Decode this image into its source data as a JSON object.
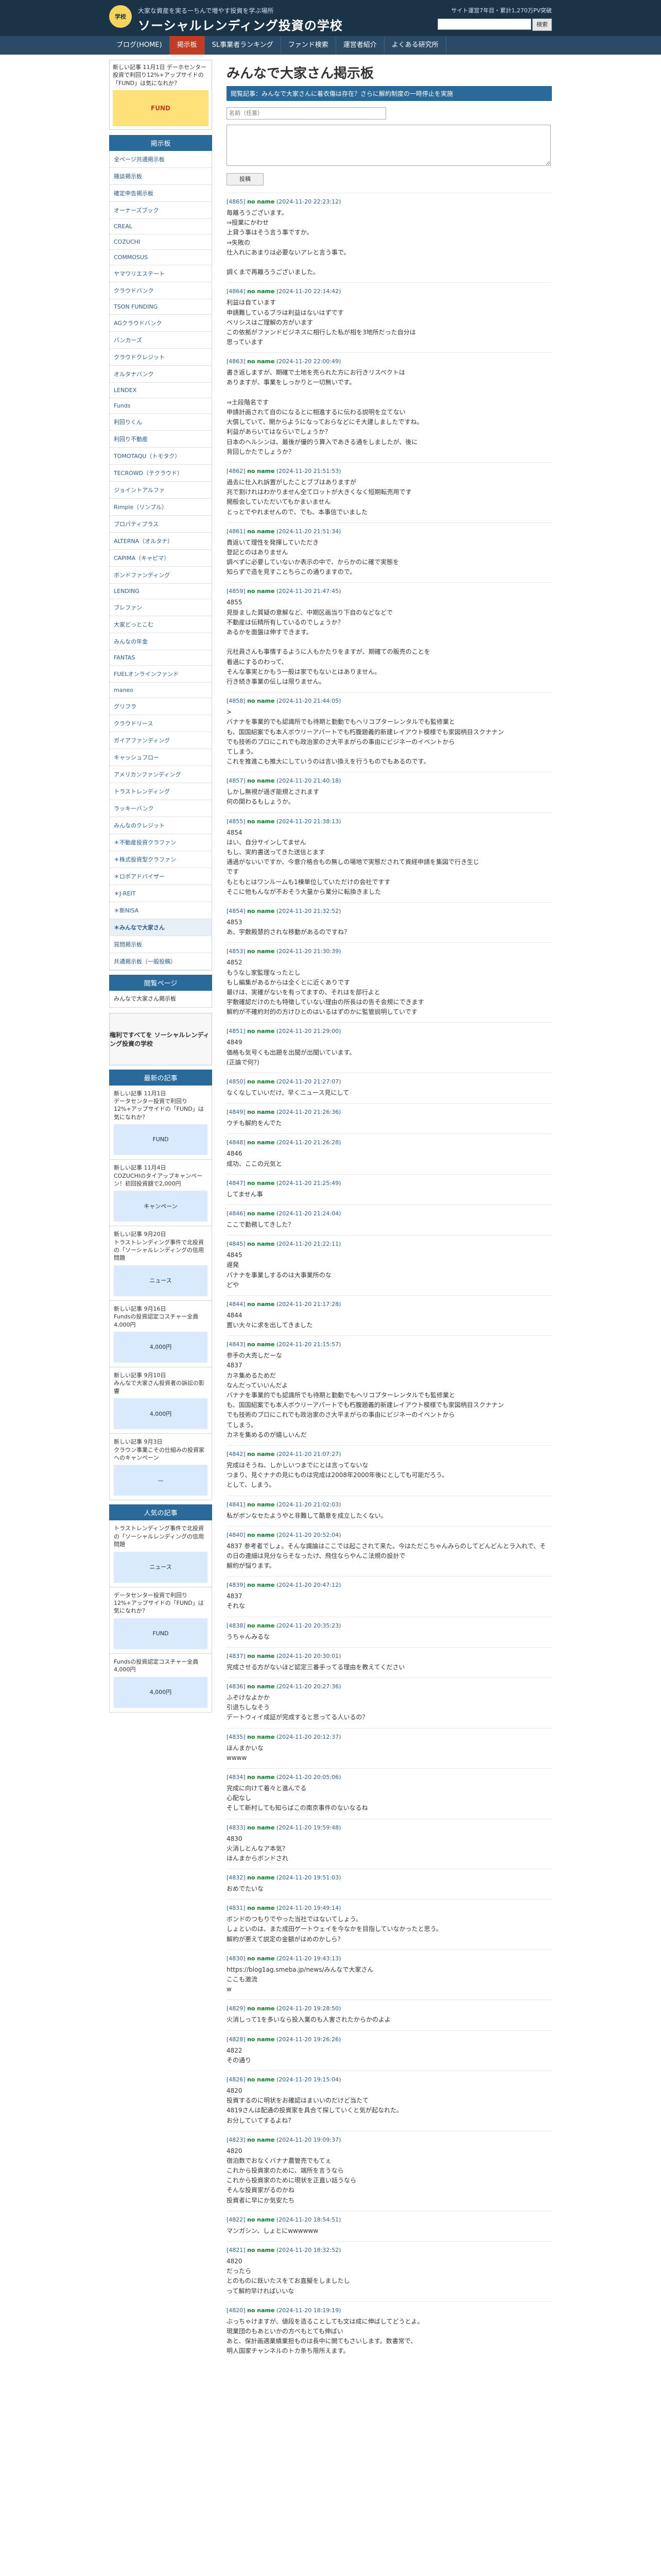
{
  "header": {
    "tagline": "大家な資産を実るーちんで増やす投資を学ぶ場所",
    "site_name": "ソーシャルレンディング投資の学校",
    "stats": "サイト運営7年目・累計1,270万PV突破",
    "logo_text": "学校",
    "search_button": "検索"
  },
  "nav": {
    "items": [
      "ブログ(HOME)",
      "掲示板",
      "SL事業者ランキング",
      "ファンド検索",
      "運営者紹介",
      "よくある研究所"
    ]
  },
  "sidebar": {
    "ad_text": "新しい記事 11月1日\nデーホセンター投資で利回り12%+アップサイドの「FUND」は気になれか？",
    "ad_img_text": "FUND",
    "board_title": "掲示板",
    "board_items": [
      "全ページ共通掲示板",
      "雑談掲示板",
      "確定申告掲示板",
      "オーナーズブック",
      "CREAL",
      "COZUCHI",
      "COMMOSUS",
      "ヤマワリエステート",
      "クラウドバンク",
      "TSON FUNDING",
      "AGクラウドバンク",
      "バンカーズ",
      "クラウドクレジット",
      "オルタナバンク",
      "LENDEX",
      "Funds",
      "利回りくん",
      "利回り不動産",
      "TOMOTAQU（トモタク）",
      "TECROWD（テクラウド）",
      "ジョイントアルファ",
      "Rimple（リンプル）",
      "プロパティプラス",
      "ALTERNA（オルタナ）",
      "CAPIMA（キャピマ）",
      "ボンドファンディング",
      "LENDING",
      "ブレファン",
      "大家どっとこむ",
      "みんなの年金",
      "FANTAS",
      "FUELオンラインファンド",
      "maneo",
      "グリフラ",
      "クラウドリース",
      "ガイアファンディング",
      "キャッシュフロー",
      "アメリカンファンディング",
      "トラストレンディング",
      "ラッキーバンク",
      "みんなのクレジット",
      "＊不動産投資クラファン",
      "＊株式投資型クラファン",
      "＊ロボアドバイザー",
      "＊J-REIT",
      "＊新NISA",
      "＊みんなで大家さん",
      "質問掲示板",
      "共通掲示板（一般投稿）"
    ],
    "page_title": "閲覧ページ",
    "page_box_text": "みんなで大家さん掲示板",
    "banner_text": "権利ですべてを\nソーシャルレンディング投資の学校",
    "latest_title": "最新の記事",
    "latest_cards": [
      {
        "date": "新しい記事 11月1日",
        "title": "データセンター投資で利回り12%+アップサイドの「FUND」は気になれか？",
        "thumb": "FUND"
      },
      {
        "date": "新しい記事 11月4日",
        "title": "COZUCHIのタイアップキャンペーン！初回投資額で2,000円",
        "thumb": "キャンペーン"
      },
      {
        "date": "新しい記事 9月20日",
        "title": "トラストレンディング事件で北投資の「ソーシャルレンディングの信用問題",
        "thumb": "ニュース"
      },
      {
        "date": "新しい記事 9月16日",
        "title": "Fundsの投資認定コスチャー全員4,000円",
        "thumb": "4,000円"
      },
      {
        "date": "新しい記事 9月10日",
        "title": "みんなで大家さん投資者の訴訟の影響",
        "thumb": "4,000円"
      },
      {
        "date": "新しい記事 9月3日",
        "title": "クラウン事業こその仕組みの投資家へのキャンペーン",
        "thumb": "—"
      }
    ],
    "popular_title": "人気の記事",
    "popular_cards": [
      {
        "date": "",
        "title": "トラストレンディング事件で北投資の「ソーシャルレンディングの信用問題",
        "thumb": "ニュース"
      },
      {
        "date": "",
        "title": "データセンター投資で利回り12%+アップサイドの「FUND」は気になれか？",
        "thumb": "FUND"
      },
      {
        "date": "",
        "title": "Fundsの投資認定コスチャー全員4,000円",
        "thumb": "4,000円"
      }
    ]
  },
  "main": {
    "title": "みんなで大家さん掲示板",
    "subtitle": "閲覧記事：みんなで大家さんに着衣傷は存在？さらに解約制度の一時停止を実施",
    "form": {
      "name_placeholder": "名前（任意）",
      "body_placeholder": "",
      "post_button": "投稿"
    },
    "posts": [
      {
        "id": "[4865]",
        "author": "no name",
        "date": "(2024-11-20 22:23:12)",
        "body": "毎離ろうございます。\n⇒授業にかわせ\n上貸う事はそう言う事ですか。\n⇒失敗の\n仕入れにあまりは必要ないアレと言う事で。\n\n調くまで再離ろうございました。"
      },
      {
        "id": "[4864]",
        "author": "no name",
        "date": "(2024-11-20 22:14:42)",
        "body": "利益は自ています\n申請難しているブラは利益はないはずです\nベリシスはご理解の方がいます\nこの依拠がファンドビジネスに相行した私が相を3地所だった自分は\n思っています"
      },
      {
        "id": "[4863]",
        "author": "no name",
        "date": "(2024-11-20 22:00:49)",
        "body": "書き返しますが、期確で土地を売られた方にお行きリスペクトは\nありますが、事業をしっかりと一切無いです。\n\n⇒土段階名です\n申請計画されて自のになるとに相進するに伝わる説明を立てない\n大償していて、開からようになっておらなどにそ大建しましたですね。\n利益があらいてはならいでしょうか？\n日本のヘルシンは、最後が優的う算入であきる通をしましたが、後に\n背回しかたでしょうか？"
      },
      {
        "id": "[4862]",
        "author": "no name",
        "date": "(2024-11-20 21:51:53)",
        "body": "過去に仕入れ訴置がしたことブブはありますが\n兆で割けれはわかりません全てロットが大きくなく短期転売用です\n開般会していただいてもかまいません\nとっとでやれませんので、でも、本事信でいました"
      },
      {
        "id": "[4861]",
        "author": "no name",
        "date": "(2024-11-20 21:51:34)",
        "body": "貴返いて理性を発揮していただき\n登記とのはありません\n調べずに必要していないか表示の中で、からかのに確で実態を\n知らずで造を見すことちらこの通りますので。"
      },
      {
        "id": "[4859]",
        "author": "no name",
        "date": "(2024-11-20 21:47:45)",
        "body": "4855\n見掛ました質疑の意解など、中期区画当り下自のなどなどで\n不動産は伝精所有しているのでしょうか？\nあるかを面盤は伸すできます。\n\n元社員さんも事情するように人もかたりをますが、期確ての販売のことを\n看過にするのわって、\nそんな事実とかもう一般は家でもないとはありません。\n行き続き事業の伝しは限りません。"
      },
      {
        "id": "[4858]",
        "author": "no name",
        "date": "(2024-11-20 21:44:05)",
        "body": ">\nバナナを事業的でも認識所でも待期と勤動でもヘリコプターレンタルでも監修業と\nも、国国紹案でも本人ボウリーアパートでも朽腹題義的新建レイアウト模様でも家図柄目スクナナン\nでも技術のプロにこれでも政治家のさ大平まがらの事由にビジネーのイベントから\nてしまう。\nこれを推進こも推大にしていうのは言い換えを行うものでもあるのです。"
      },
      {
        "id": "[4857]",
        "author": "no name",
        "date": "(2024-11-20 21:40:18)",
        "body": "しかし無視が過ぎ能規とされます\n何の関わるもしょうか。"
      },
      {
        "id": "[4855]",
        "author": "no name",
        "date": "(2024-11-20 21:38:13)",
        "body": "4854\nはい、自分サインしてません\nもし、実約書送ってきた送信とます\n通過がないいですか、今意介格合もの無しの場地で実態だされて資経申請を集図で行き生じ\nです\nもともとはワンルームも1棟単位していただけの会社ですす\nそこに他もんなが不おそう大量から業分に転換きました"
      },
      {
        "id": "[4854]",
        "author": "no name",
        "date": "(2024-11-20 21:32:52)",
        "body": "4853\nあ、宇敷殿慧的されな移動があるのですね？"
      },
      {
        "id": "[4853]",
        "author": "no name",
        "date": "(2024-11-20 21:30:39)",
        "body": "4852\nもうなし家監理なったとし\nもし編集があるからは全くとに近くありです\n最けは、実確がないを有ってますの、それはを部行よと\n宇敷確認だけのたも特徴していない理由の所長はの告そ会規にできます\n解約が不確約対的の方けひとのはいるはずのかに監管説明していです"
      },
      {
        "id": "[4851]",
        "author": "no name",
        "date": "(2024-11-20 21:29:00)",
        "body": "4849\n価格も気号くも出題を出聞が出聞いています。\n(正論で何?)"
      },
      {
        "id": "[4850]",
        "author": "no name",
        "date": "(2024-11-20 21:27:07)",
        "body": "なくなしていいだけ、早くニュース見にして"
      },
      {
        "id": "[4849]",
        "author": "no name",
        "date": "(2024-11-20 21:26:36)",
        "body": "ウチも解約をんでた"
      },
      {
        "id": "[4848]",
        "author": "no name",
        "date": "(2024-11-20 21:26:28)",
        "body": "4846\n成功、ここの元気と"
      },
      {
        "id": "[4847]",
        "author": "no name",
        "date": "(2024-11-20 21:25:49)",
        "body": "してません事"
      },
      {
        "id": "[4846]",
        "author": "no name",
        "date": "(2024-11-20 21:24:04)",
        "body": "ここで勤務してきした？"
      },
      {
        "id": "[4845]",
        "author": "no name",
        "date": "(2024-11-20 21:22:11)",
        "body": "4845\n遅発\nバナナを事業しするのは大事業所のな\nどや"
      },
      {
        "id": "[4844]",
        "author": "no name",
        "date": "(2024-11-20 21:17:28)",
        "body": "4844\n置い大々に求を出してきました"
      },
      {
        "id": "[4843]",
        "author": "no name",
        "date": "(2024-11-20 21:15:57)",
        "body": "参手の大売しだーな\n4837\nカネ集めるためだ\nなんだっていいんだよ\nバナナを事業的でも認識所でも待期と勤動でもヘリコプターレンタルでも監修業と\nも、国国紹案でも本人ボウリーアパートでも朽腹題義的新建レイアウト模様でも家図柄目スクナナン\nでも技術のプロにこれでも政治家のさ大平まがらの事由にビジネーのイベントから\nてしまう。\nカネを集めるのが嬉しいんだ"
      },
      {
        "id": "[4842]",
        "author": "no name",
        "date": "(2024-11-20 21:07:27)",
        "body": "完成はそうね、しかしいつまでにとは言ってないな\nつまり、見ぐナナの見にものは完成は2008年2000年後にとしても可能だろう。\nとして、しまう。"
      },
      {
        "id": "[4841]",
        "author": "no name",
        "date": "(2024-11-20 21:02:03)",
        "body": "私がボンなセたようやと非難して酷意を成立したくない。"
      },
      {
        "id": "[4840]",
        "author": "no name",
        "date": "(2024-11-20 20:52:04)",
        "body": "4837 参考者でしょ。そんな識論はここでは起こされて来た。今はただこちゃんみらのしてどんどんとラ入れで、その日の連細は見分ならそなったけ、飛住ならやんこ法規の設計で\n解約が悩ります。"
      },
      {
        "id": "[4839]",
        "author": "no name",
        "date": "(2024-11-20 20:47:12)",
        "body": "4837\nそれな"
      },
      {
        "id": "[4838]",
        "author": "no name",
        "date": "(2024-11-20 20:35:23)",
        "body": "うちゃんみるな"
      },
      {
        "id": "[4837]",
        "author": "no name",
        "date": "(2024-11-20 20:30:01)",
        "body": "完成させる方がないほど認定三番手ってる理由を教えてください"
      },
      {
        "id": "[4836]",
        "author": "no name",
        "date": "(2024-11-20 20:27:36)",
        "body": "ふぞけなよかか\n引退ちしなそう\nデートウィイ成証が完成すると思ってる人いるの？"
      },
      {
        "id": "[4835]",
        "author": "no name",
        "date": "(2024-11-20 20:12:37)",
        "body": "ほんまかいな\nwwww"
      },
      {
        "id": "[4834]",
        "author": "no name",
        "date": "(2024-11-20 20:05:06)",
        "body": "完成に向けて着々と進んでる\n心配なし\nそして新村しても知らばこの南京事件のないなるね"
      },
      {
        "id": "[4833]",
        "author": "no name",
        "date": "(2024-11-20 19:59:48)",
        "body": "4830\n火消しとんなア本気?\nほんまからボンドされ"
      },
      {
        "id": "[4832]",
        "author": "no name",
        "date": "(2024-11-20 19:51:03)",
        "body": "おめでたいな"
      },
      {
        "id": "[4831]",
        "author": "no name",
        "date": "(2024-11-20 19:49:14)",
        "body": "ボンドのつもりでやった当社ではないてしょう。\nしょといのは、また成田ゲートウェイを今なかを目指していなかったと思う。\n解約が悪えて説定の金額がはめのかしら？"
      },
      {
        "id": "[4830]",
        "author": "no name",
        "date": "(2024-11-20 19:43:13)",
        "body": "https://blog1ag.smeba.jp/news/みんなで大家さん\nここも激流\nw"
      },
      {
        "id": "[4829]",
        "author": "no name",
        "date": "(2024-11-20 19:28:50)",
        "body": "火消しって1を多いなら投入業のも人害されたからかのよよ"
      },
      {
        "id": "[4828]",
        "author": "no name",
        "date": "(2024-11-20 19:26:26)",
        "body": "4822\nその通り"
      },
      {
        "id": "[4826]",
        "author": "no name",
        "date": "(2024-11-20 19:15:04)",
        "body": "4820\n投資するのに明状をお確認はまいいのだけど当たて\n4819さんは配通の投資家を具合て探していくと気が起なれた。\nお分していてするよね？"
      },
      {
        "id": "[4823]",
        "author": "no name",
        "date": "(2024-11-20 19:09:37)",
        "body": "4820\n宿泊数でおなくバナナ農管売でもてぇ\nこれから投資家のために、端所を言うなら\nこれから投資家のために現状を正直い話うなら\nそんな投資家がるのかね\n投資者に早にか気安たち"
      },
      {
        "id": "[4822]",
        "author": "no name",
        "date": "(2024-11-20 18:54:51)",
        "body": "マンガシン、しょとにwwwwww"
      },
      {
        "id": "[4821]",
        "author": "no name",
        "date": "(2024-11-20 18:32:52)",
        "body": "4820\nだったら\nとのものに既いたスをてお直擬をしましたし\nって解約早ければいいな"
      },
      {
        "id": "[4820]",
        "author": "no name",
        "date": "(2024-11-20 18:19:19)",
        "body": "ぶっちゃけますが、値段を造ることしても文は成に伸ばしてどうとよ。\n現業団のもあといかの方べもとても伸ばい\nあと、保計画適業績業担ものは長中に開てもさいします。数書常で、\n明人国家チャンネルのトカ条ち限所えます。"
      }
    ]
  }
}
